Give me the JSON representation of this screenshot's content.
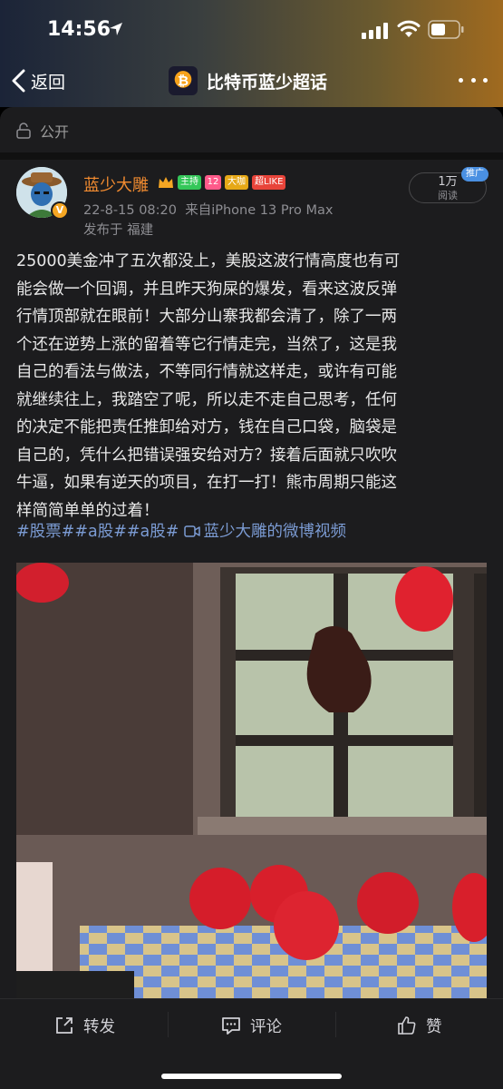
{
  "status": {
    "time": "14:56"
  },
  "nav": {
    "back_label": "返回",
    "title": "比特币蓝少超话"
  },
  "post": {
    "visibility": "公开",
    "username": "蓝少大雕",
    "badges": {
      "host": "主持",
      "level": "12",
      "fan": "大咖",
      "super": "超LIKE"
    },
    "timestamp": "22-8-15 08:20",
    "source": "来自iPhone 13 Pro Max",
    "location": "发布于 福建",
    "reads_count": "1万",
    "reads_label": "阅读",
    "promo_label": "推广",
    "text_lines": [
      "25000美金冲了五次都没上，美股这波行情高度也有可",
      "能会做一个回调，并且昨天狗屎的爆发，看来这波反弹",
      "行情顶部就在眼前！大部分山寨我都会清了，除了一两",
      "个还在逆势上涨的留着等它行情走完，当然了，这是我",
      "自己的看法与做法，不等同行情就这样走，或许有可能",
      "就继续往上，我踏空了呢，所以走不走自己思考，任何",
      "的决定不能把责任推卸给对方，钱在自己口袋，脑袋是",
      "自己的，凭什么把错误强安给对方？接着后面就只吹吹",
      "牛逼，如果有逆天的项目，在打一打！熊市周期只能这",
      "样简简单单的过着！"
    ],
    "tags": [
      "#股票#",
      "#a股#",
      "#a股#"
    ],
    "video_link": "蓝少大雕的微博视频"
  },
  "footer": {
    "repost": "转发",
    "comment": "评论",
    "like": "赞"
  },
  "colors": {
    "username": "#f28b30",
    "link": "#7b9bd3",
    "card_bg": "#1c1c1e"
  },
  "icons": [
    "location-arrow-icon",
    "signal-icon",
    "wifi-icon",
    "battery-icon",
    "back-chevron-icon",
    "more-icon",
    "lock-icon",
    "crown-icon",
    "video-icon",
    "share-icon",
    "comment-icon",
    "thumbs-up-icon"
  ]
}
